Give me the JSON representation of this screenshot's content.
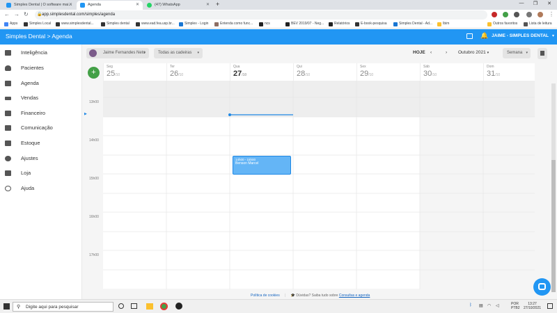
{
  "browser": {
    "tabs": [
      {
        "label": "Simples Dental | O software mai..."
      },
      {
        "label": "Agenda"
      },
      {
        "label": "(47) WhatsApp"
      }
    ],
    "new_tab": "+",
    "url": "app.simplesdental.com/simples/agenda",
    "bookmarks": [
      "Apps",
      "Simples Local",
      "www.simplesdental...",
      "Simples dental",
      "www.ead.fea.usp.br...",
      "Simplex - Login",
      "Entenda como func...",
      "ncs",
      "BEV 2019/07 - Neg...",
      "Relatórios",
      "E-book-pesquisa",
      "Simples Dental - Ad...",
      "Ibim",
      "Outros favoritos",
      "Lista de leitura"
    ]
  },
  "appbar": {
    "brand": "Simples Dental > Agenda",
    "user": "JAIME - SIMPLES DENTAL"
  },
  "sidebar": {
    "items": [
      {
        "label": "Inteligência",
        "icon": "chart-icon"
      },
      {
        "label": "Pacientes",
        "icon": "person-icon"
      },
      {
        "label": "Agenda",
        "icon": "calendar-icon"
      },
      {
        "label": "Vendas",
        "icon": "sales-icon"
      },
      {
        "label": "Financeiro",
        "icon": "money-icon"
      },
      {
        "label": "Comunicação",
        "icon": "chat-icon"
      },
      {
        "label": "Estoque",
        "icon": "box-icon"
      },
      {
        "label": "Ajustes",
        "icon": "gear-icon"
      },
      {
        "label": "Loja",
        "icon": "cart-icon"
      },
      {
        "label": "Ajuda",
        "icon": "help-icon"
      }
    ]
  },
  "toolbar": {
    "professional": "Jaime Fernandes Neto",
    "chairs": "Todas as cadeiras",
    "today": "HOJE",
    "month": "Outubro 2021",
    "view": "Semana"
  },
  "days": [
    {
      "name": "Seg",
      "date": "25",
      "month": "/10"
    },
    {
      "name": "Ter",
      "date": "26",
      "month": "/10"
    },
    {
      "name": "Qua",
      "date": "27",
      "month": "/10"
    },
    {
      "name": "Qui",
      "date": "28",
      "month": "/10"
    },
    {
      "name": "Sex",
      "date": "29",
      "month": "/10"
    },
    {
      "name": "Sáb",
      "date": "30",
      "month": "/10"
    },
    {
      "name": "Dom",
      "date": "31",
      "month": "/10"
    }
  ],
  "hours": [
    "13h00",
    "14h00",
    "15h00",
    "16h00",
    "17h00"
  ],
  "event": {
    "time": "14h00 - 15h00",
    "name": "Benson Marcel"
  },
  "footer": {
    "policy": "Política de cookies",
    "help": "Dúvidas? Saiba tudo sobre",
    "link": "Consultas e agenda"
  },
  "taskbar": {
    "search": "Digite aqui para pesquisar",
    "lang": "POR",
    "layout": "PTB2",
    "time": "13:27",
    "date": "27/10/2021"
  },
  "colors": {
    "primary": "#2196f3",
    "fab": "#43a047",
    "event": "#64b5f6"
  }
}
